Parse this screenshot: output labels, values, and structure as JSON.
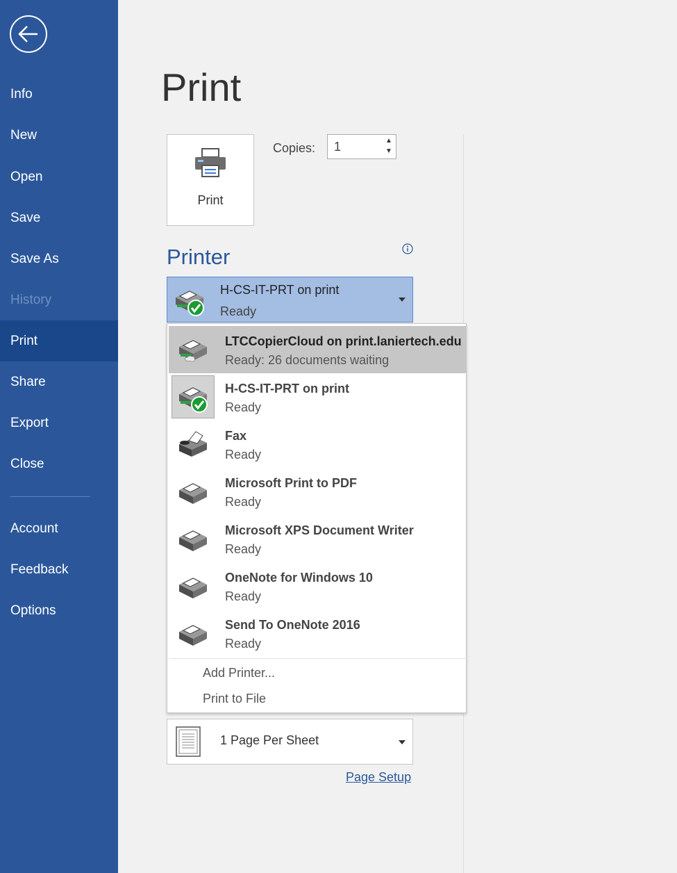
{
  "sidebar": {
    "items": [
      {
        "label": "Info"
      },
      {
        "label": "New"
      },
      {
        "label": "Open"
      },
      {
        "label": "Save"
      },
      {
        "label": "Save As"
      },
      {
        "label": "History"
      },
      {
        "label": "Print"
      },
      {
        "label": "Share"
      },
      {
        "label": "Export"
      },
      {
        "label": "Close"
      },
      {
        "label": "Account"
      },
      {
        "label": "Feedback"
      },
      {
        "label": "Options"
      }
    ],
    "active": "Print",
    "disabled": "History"
  },
  "main": {
    "title": "Print",
    "print_button_label": "Print",
    "copies_label": "Copies:",
    "copies_value": "1",
    "printer_heading": "Printer",
    "selected_printer": {
      "name": "H-CS-IT-PRT on print",
      "status": "Ready"
    },
    "printers": [
      {
        "name": "LTCCopierCloud on print.laniertech.edu",
        "status": "Ready: 26 documents waiting",
        "icon": "printer-cloud-icon"
      },
      {
        "name": "H-CS-IT-PRT on print",
        "status": "Ready",
        "icon": "printer-default-icon"
      },
      {
        "name": "Fax",
        "status": "Ready",
        "icon": "fax-icon"
      },
      {
        "name": "Microsoft Print to PDF",
        "status": "Ready",
        "icon": "printer-icon"
      },
      {
        "name": "Microsoft XPS Document Writer",
        "status": "Ready",
        "icon": "printer-icon"
      },
      {
        "name": "OneNote for Windows 10",
        "status": "Ready",
        "icon": "printer-icon"
      },
      {
        "name": "Send To OneNote 2016",
        "status": "Ready",
        "icon": "printer-icon"
      }
    ],
    "add_printer_label": "Add Printer...",
    "print_to_file_label": "Print to File",
    "pages_per_sheet": "1 Page Per Sheet",
    "page_setup_label": "Page Setup"
  },
  "colors": {
    "accent": "#2b579a",
    "sidebar_active": "#19478a",
    "selected_printer_bg": "#a3bde3",
    "highlight_bg": "#c6c6c6",
    "status_green": "#0f9d2c"
  }
}
